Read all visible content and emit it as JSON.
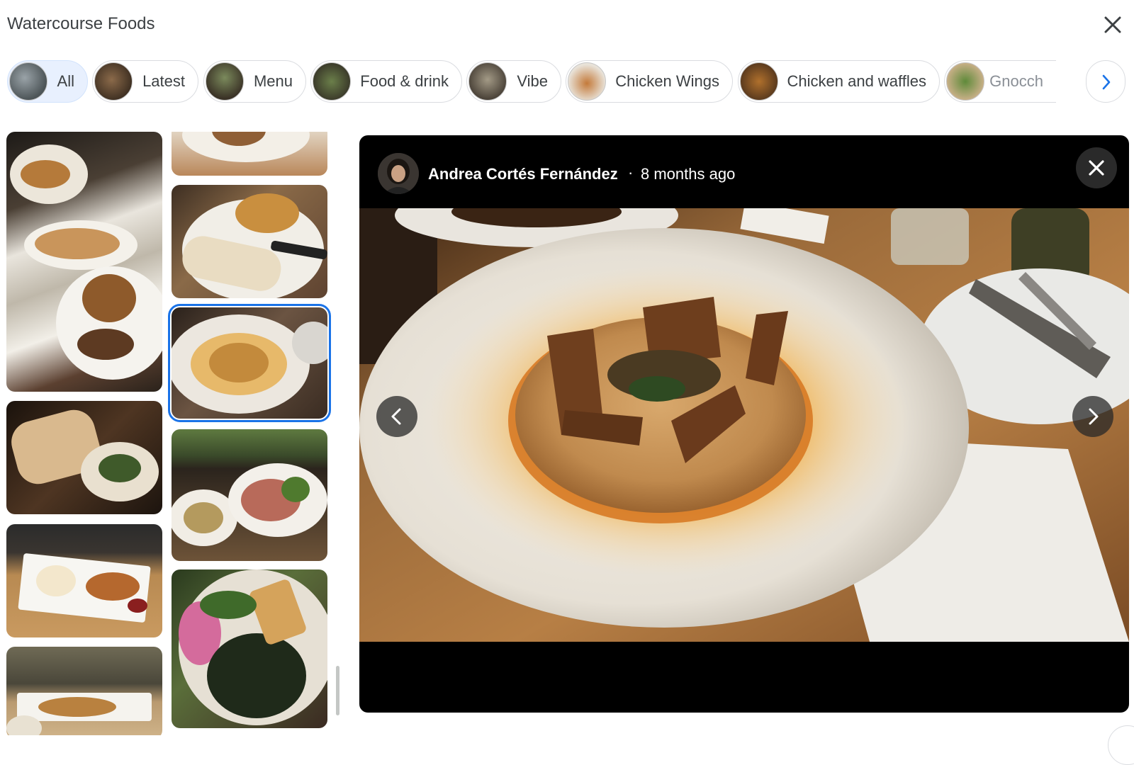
{
  "window": {
    "title": "Watercourse Foods"
  },
  "chips": [
    {
      "label": "All",
      "active": true
    },
    {
      "label": "Latest",
      "active": false
    },
    {
      "label": "Menu",
      "active": false
    },
    {
      "label": "Food & drink",
      "active": false
    },
    {
      "label": "Vibe",
      "active": false
    },
    {
      "label": "Chicken Wings",
      "active": false
    },
    {
      "label": "Chicken and waffles",
      "active": false
    },
    {
      "label": "Gnocch",
      "active": false
    }
  ],
  "viewer": {
    "author": "Andrea Cortés Fernández",
    "separator": "·",
    "time_ago": "8 months ago"
  },
  "grid": {
    "selected_index": 2
  },
  "icons": {
    "close": "close-icon",
    "next": "chevron-right-icon",
    "prev": "chevron-left-icon"
  },
  "colors": {
    "accent": "#1a73e8",
    "active_chip": "#e8f0fe",
    "viewer_bg": "#000000"
  }
}
